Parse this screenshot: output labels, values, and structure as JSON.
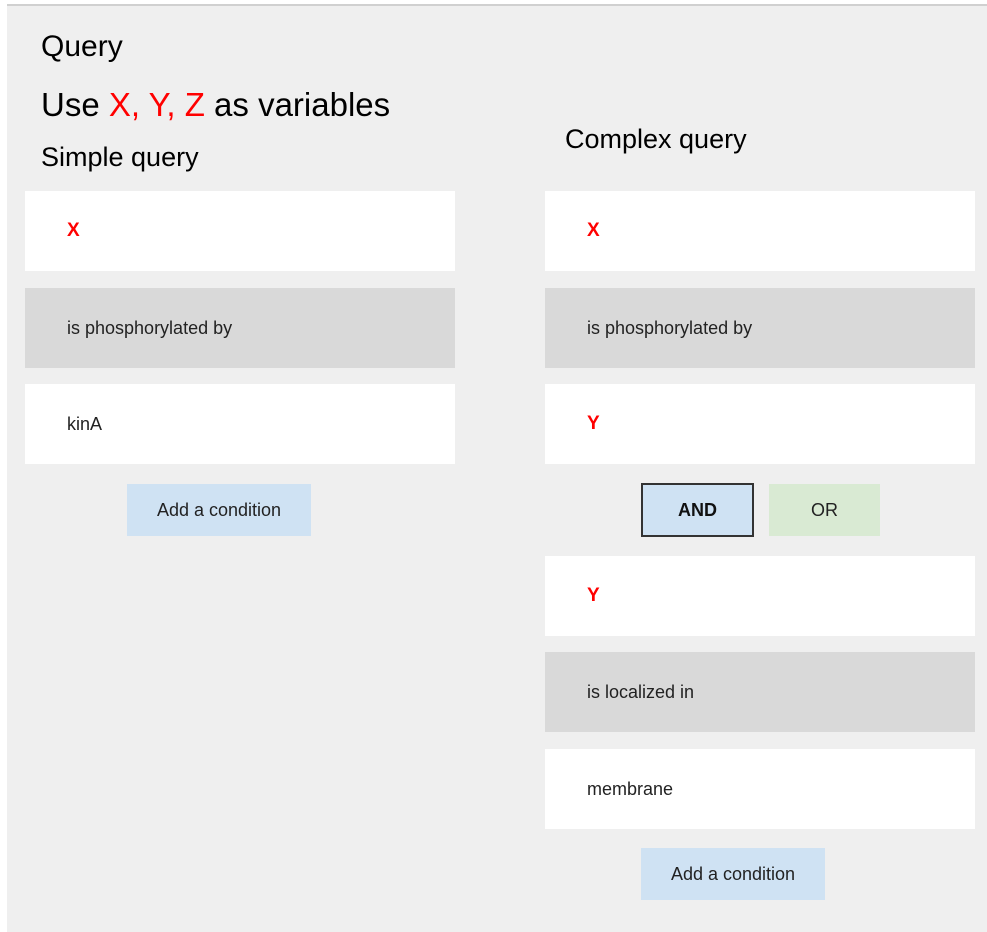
{
  "header": {
    "title": "Query",
    "vars_prefix": "Use ",
    "vars": [
      "X, ",
      "Y, ",
      "Z"
    ],
    "vars_suffix": " as variables"
  },
  "simple": {
    "heading": "Simple query",
    "subject": "X",
    "relation": "is phosphorylated by",
    "object": "kinA",
    "add_label": "Add a condition"
  },
  "complex": {
    "heading": "Complex query",
    "cond1": {
      "subject": "X",
      "relation": "is phosphorylated by",
      "object": "Y"
    },
    "and_label": "AND",
    "or_label": "OR",
    "cond2": {
      "subject": "Y",
      "relation": "is localized in",
      "object": "membrane"
    },
    "add_label": "Add a condition"
  },
  "colors": {
    "variable": "#ff0000",
    "and_bg": "#cfe2f3",
    "or_bg": "#d9ead3",
    "relation_bg": "#d9d9d9"
  }
}
